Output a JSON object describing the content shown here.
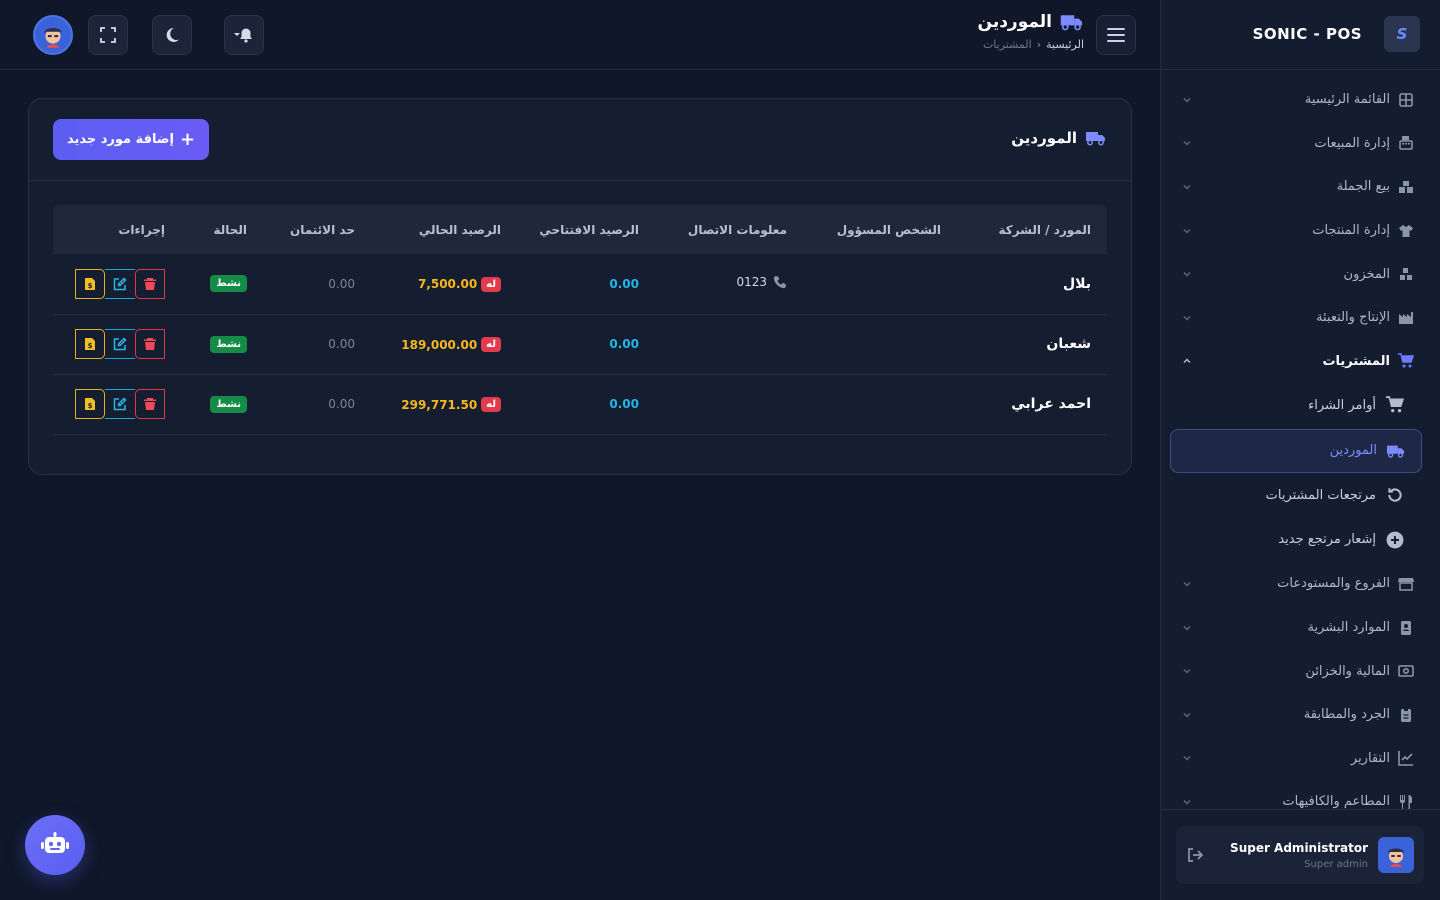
{
  "brand": {
    "name": "SONIC - POS",
    "logo_text": "S"
  },
  "header": {
    "title": "الموردين",
    "breadcrumb": {
      "home": "الرئيسية",
      "separator": "›",
      "current": "المشتريات"
    }
  },
  "sidebar": {
    "menu": [
      {
        "label": "القائمة الرئيسية",
        "icon": "grid-icon"
      },
      {
        "label": "إدارة المبيعات",
        "icon": "cash-register-icon"
      },
      {
        "label": "بيع الجملة",
        "icon": "boxes-icon"
      },
      {
        "label": "إدارة المنتجات",
        "icon": "shirt-icon"
      },
      {
        "label": "المخزون",
        "icon": "stock-icon"
      },
      {
        "label": "الإنتاج والتعبئة",
        "icon": "factory-icon"
      },
      {
        "label": "المشتريات",
        "icon": "cart-icon",
        "open": true
      }
    ],
    "submenu": [
      {
        "label": "أوامر الشراء",
        "icon": "cart-icon"
      },
      {
        "label": "الموردين",
        "icon": "truck-icon",
        "active": true
      },
      {
        "label": "مرتجعات المشتريات",
        "icon": "undo-icon"
      },
      {
        "label": "إشعار مرتجع جديد",
        "icon": "plus-circle-icon"
      }
    ],
    "menu_after": [
      {
        "label": "الفروع والمستودعات",
        "icon": "store-icon"
      },
      {
        "label": "الموارد البشرية",
        "icon": "id-card-icon"
      },
      {
        "label": "المالية والخزائن",
        "icon": "money-icon"
      },
      {
        "label": "الجرد والمطابقة",
        "icon": "clipboard-icon"
      },
      {
        "label": "التقارير",
        "icon": "chart-line-icon"
      },
      {
        "label": "المطاعم والكافيهات",
        "icon": "utensils-icon"
      }
    ],
    "user": {
      "name": "Super Administrator",
      "role": "Super admin"
    }
  },
  "card": {
    "title": "الموردين",
    "add_button": "إضافة مورد جديد",
    "add_button_icon": "+"
  },
  "table": {
    "columns": [
      "المورد / الشركة",
      "الشخص المسؤول",
      "معلومات الاتصال",
      "الرصيد الافتتاحي",
      "الرصيد الحالي",
      "حد الائتمان",
      "الحالة",
      "إجراءات"
    ],
    "rows": [
      {
        "name": "بلال",
        "contact_person": "",
        "phone": "0123",
        "opening": "0.00",
        "balance_badge": "له",
        "balance": "7,500.00",
        "credit": "0.00",
        "status": "نشط"
      },
      {
        "name": "شعبان",
        "contact_person": "",
        "phone": "",
        "opening": "0.00",
        "balance_badge": "له",
        "balance": "189,000.00",
        "credit": "0.00",
        "status": "نشط"
      },
      {
        "name": "احمد عرابي",
        "contact_person": "",
        "phone": "",
        "opening": "0.00",
        "balance_badge": "له",
        "balance": "299,771.50",
        "credit": "0.00",
        "status": "نشط"
      }
    ]
  },
  "colors": {
    "background": "#0f1729",
    "accent": "#6d7cff",
    "positive": "#168a47",
    "balance": "#f6b81c",
    "opening": "#22b7e6",
    "danger": "#e23b4b"
  }
}
